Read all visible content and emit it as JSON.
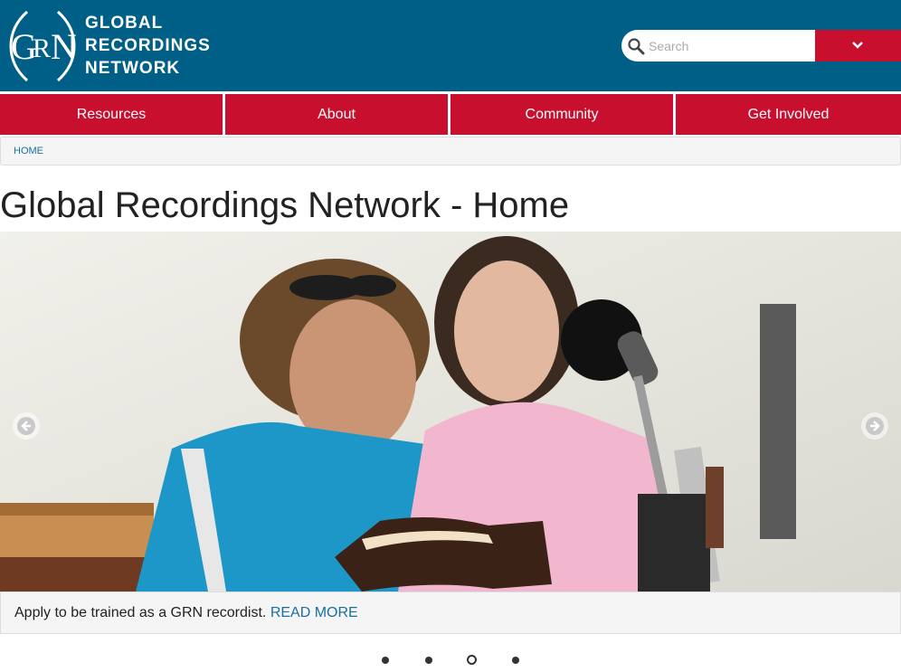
{
  "header": {
    "logo_mark": "GRN",
    "logo_lines": [
      "GLOBAL",
      "RECORDINGS",
      "NETWORK"
    ],
    "background_color": "#005f86"
  },
  "search": {
    "placeholder": "Search",
    "icon": "search-icon",
    "dropdown_icon": "chevron-down-icon",
    "dropdown_color": "#c8102e"
  },
  "nav": {
    "items": [
      {
        "label": "Resources"
      },
      {
        "label": "About"
      },
      {
        "label": "Community"
      },
      {
        "label": "Get Involved"
      }
    ],
    "color": "#c8102e"
  },
  "breadcrumb": {
    "items": [
      "HOME"
    ]
  },
  "page": {
    "title": "Global Recordings Network - Home"
  },
  "carousel": {
    "prev_icon": "arrow-left-icon",
    "next_icon": "arrow-right-icon",
    "caption_text": "Apply to be trained as a GRN recordist.",
    "caption_link": "READ MORE",
    "slide_count": 4,
    "active_slide": 3
  }
}
